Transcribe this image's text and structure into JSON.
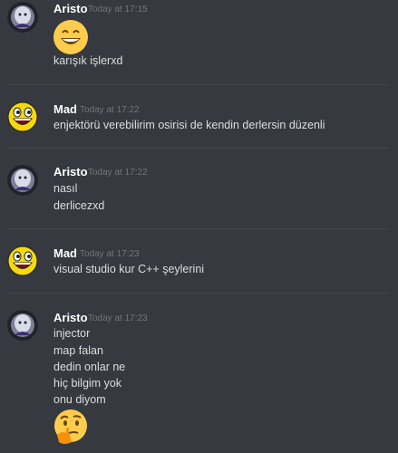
{
  "messages": [
    {
      "username": "Aristo",
      "timestamp": "Today at 17:15",
      "lines": [
        "karışık işlerxd"
      ],
      "emoji": "grinning-emoji"
    },
    {
      "username": "Mad",
      "timestamp": "Today at 17:22",
      "lines": [
        "enjektörü verebilirim osirisi de kendin derlersin düzenli"
      ]
    },
    {
      "username": "Aristo",
      "timestamp": "Today at 17:22",
      "lines": [
        "nasıl",
        "derlicezxd"
      ]
    },
    {
      "username": "Mad",
      "timestamp": "Today at 17:23",
      "lines": [
        "visual studio kur C++ şeylerini"
      ]
    },
    {
      "username": "Aristo",
      "timestamp": "Today at 17:23",
      "lines": [
        "injector",
        "map falan",
        "dedin onlar ne",
        "hiç bilgim yok",
        "onu diyom"
      ],
      "emoji": "thinking-emoji"
    }
  ],
  "colors": {
    "background": "#36393f",
    "username": "#ffffff",
    "timestamp": "#72767d",
    "text": "#dcddde",
    "divider": "#42454a"
  }
}
